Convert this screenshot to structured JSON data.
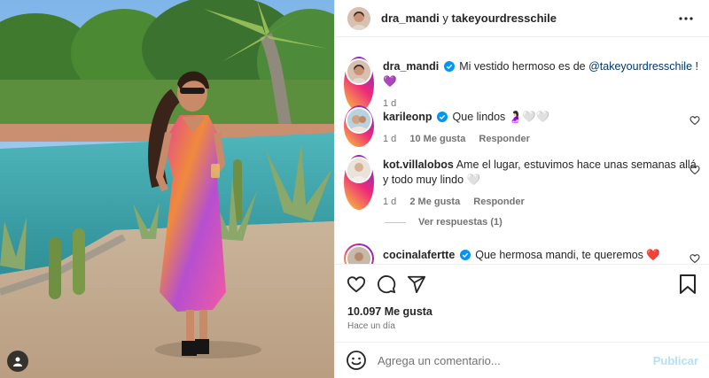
{
  "header": {
    "user1": "dra_mandi",
    "conj": "y",
    "user2": "takeyourdresschile"
  },
  "caption": {
    "user": "dra_mandi",
    "text": "Mi vestido hermoso es de",
    "mention": "@takeyourdresschile",
    "suffix": " ! 💜",
    "age": "1 d"
  },
  "comments": [
    {
      "user": "karileonp",
      "verified": true,
      "text": "Que lindos 🤰🏻🤍🤍",
      "age": "1 d",
      "likes": "10 Me gusta",
      "reply": "Responder"
    },
    {
      "user": "kot.villalobos",
      "verified": false,
      "text": "Ame el lugar, estuvimos hace unas semanas allá y todo muy lindo 🤍",
      "age": "1 d",
      "likes": "2 Me gusta",
      "reply": "Responder"
    },
    {
      "user": "cocinalafertte",
      "verified": true,
      "text": "Que hermosa mandi, te queremos ❤️"
    }
  ],
  "view_replies": "Ver respuestas (1)",
  "likes_count": "10.097 Me gusta",
  "posted": "Hace un día",
  "add_comment": {
    "placeholder": "Agrega un comentario...",
    "publish": "Publicar"
  },
  "colors": {
    "accent": "#0095f6",
    "publish_disabled": "#b2dffc",
    "verified": "#0095f6"
  },
  "icons": [
    "more-icon",
    "heart-icon",
    "comment-icon",
    "share-icon",
    "save-icon",
    "emoji-icon",
    "user-tag-icon",
    "verified-icon"
  ]
}
